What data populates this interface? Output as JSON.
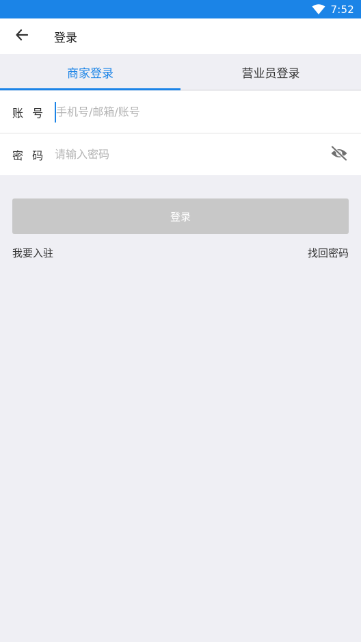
{
  "status_bar": {
    "time": "7:52",
    "wifi_icon": "wifi-icon"
  },
  "app_bar": {
    "back_icon": "arrow-left-icon",
    "title": "登录"
  },
  "tabs": [
    {
      "label": "商家登录",
      "active": true
    },
    {
      "label": "营业员登录",
      "active": false
    }
  ],
  "form": {
    "account_label": "账 号",
    "account_placeholder": "手机号/邮箱/账号",
    "account_value": "",
    "password_label": "密 码",
    "password_placeholder": "请输入密码",
    "password_value": "",
    "visibility_icon": "eye-off-icon"
  },
  "login_button": "登录",
  "links": {
    "register": "我要入驻",
    "forgot_password": "找回密码"
  },
  "colors": {
    "accent": "#1b84e7",
    "background": "#efeff4",
    "disabled_button": "#c8c8c8"
  }
}
